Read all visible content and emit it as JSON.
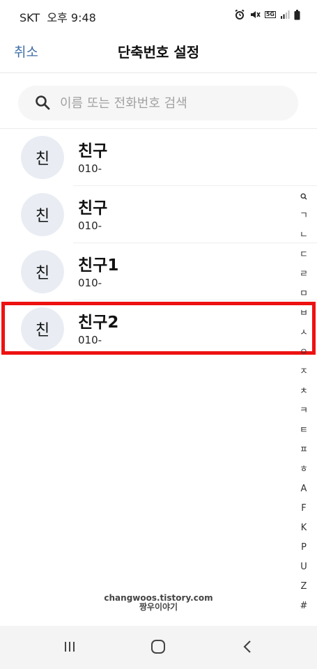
{
  "status": {
    "carrier": "SKT",
    "time": "오후 9:48",
    "network": "5G"
  },
  "header": {
    "cancel_label": "취소",
    "title": "단축번호 설정"
  },
  "search": {
    "placeholder": "이름 또는 전화번호 검색",
    "value": ""
  },
  "contacts": [
    {
      "avatar": "친",
      "name": "친구",
      "number": "010-"
    },
    {
      "avatar": "친",
      "name": "친구",
      "number": "010-"
    },
    {
      "avatar": "친",
      "name": "친구1",
      "number": "010-"
    },
    {
      "avatar": "친",
      "name": "친구2",
      "number": "010-",
      "highlighted": true
    }
  ],
  "index_bar": [
    "ㄱ",
    "ㄴ",
    "ㄷ",
    "ㄹ",
    "ㅁ",
    "ㅂ",
    "ㅅ",
    "ㅇ",
    "ㅈ",
    "ㅊ",
    "ㅋ",
    "ㅌ",
    "ㅍ",
    "ㅎ",
    "A",
    "F",
    "K",
    "P",
    "U",
    "Z",
    "#"
  ],
  "watermark": {
    "line1": "changwoos.tistory.com",
    "line2": "짱우이야기"
  },
  "colors": {
    "accent": "#3f6ea8",
    "highlight_border": "#ee1111",
    "avatar_bg": "#e9edf3"
  },
  "icons": {
    "search": "search-icon",
    "alarm": "alarm-icon",
    "mute": "mute-icon",
    "signal": "signal-icon",
    "battery": "battery-icon",
    "recent_apps": "recent-apps-icon",
    "home": "home-icon",
    "back": "back-icon"
  }
}
